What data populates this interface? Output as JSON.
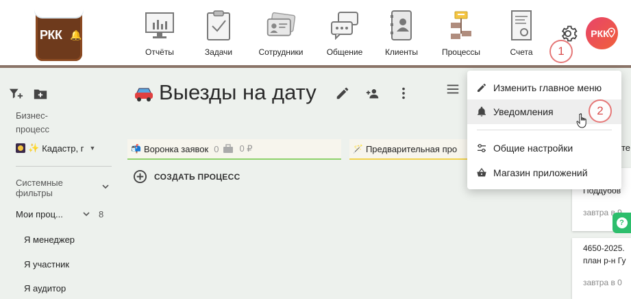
{
  "logo": {
    "text": "РКК"
  },
  "nav": {
    "items": [
      {
        "label": "Отчёты",
        "icon": "reports-icon"
      },
      {
        "label": "Задачи",
        "icon": "tasks-icon"
      },
      {
        "label": "Сотрудники",
        "icon": "employees-icon"
      },
      {
        "label": "Общение",
        "icon": "chat-icon"
      },
      {
        "label": "Клиенты",
        "icon": "clients-icon"
      },
      {
        "label": "Процессы",
        "icon": "processes-icon"
      },
      {
        "label": "Счета",
        "icon": "invoices-icon"
      }
    ]
  },
  "user": {
    "avatar_text": "РКК"
  },
  "annotations": {
    "step1": "1",
    "step2": "2"
  },
  "sidebar": {
    "section_label": "Бизнес-\nпроцесс",
    "section_label_line1": "Бизнес-",
    "section_label_line2": "процесс",
    "selected_process": "Кадастр, г",
    "system_filters_line1": "Системные",
    "system_filters_line2": "фильтры",
    "my_processes": {
      "label": "Мои проц...",
      "count": "8"
    },
    "filters": [
      "Я менеджер",
      "Я участник",
      "Я аудитор"
    ]
  },
  "main": {
    "title": "Выезды на дату",
    "columns": [
      {
        "title": "Воронка заявок",
        "count": "0",
        "sum": "0 ₽",
        "accent": "#8fd16a"
      },
      {
        "title": "Предварительная про",
        "accent": "#f2d24b"
      }
    ],
    "create_process_label": "СОЗДАТЬ ПРОЦЕСС",
    "cards": [
      {
        "line1": "...2025.",
        "line2": "Поддубов",
        "footer": "завтра в 9"
      },
      {
        "line1": "4650-2025.",
        "line2": "план р-н Гу",
        "footer": "завтра в 0"
      }
    ],
    "partial_header_text": "те"
  },
  "help": {
    "label": "?"
  },
  "menu": {
    "items": [
      {
        "label": "Изменить главное меню",
        "icon": "pencil-icon"
      },
      {
        "label": "Уведомления",
        "icon": "bell-icon",
        "hovered": true
      },
      {
        "label": "Общие настройки",
        "icon": "settings-sliders-icon"
      },
      {
        "label": "Магазин приложений",
        "icon": "basket-icon"
      }
    ]
  },
  "colors": {
    "topbar_border": "#8a7468",
    "accent_red": "#e57777",
    "avatar_gradient": [
      "#e8446a",
      "#f0603a"
    ],
    "help_green": "#2dbe6c"
  }
}
